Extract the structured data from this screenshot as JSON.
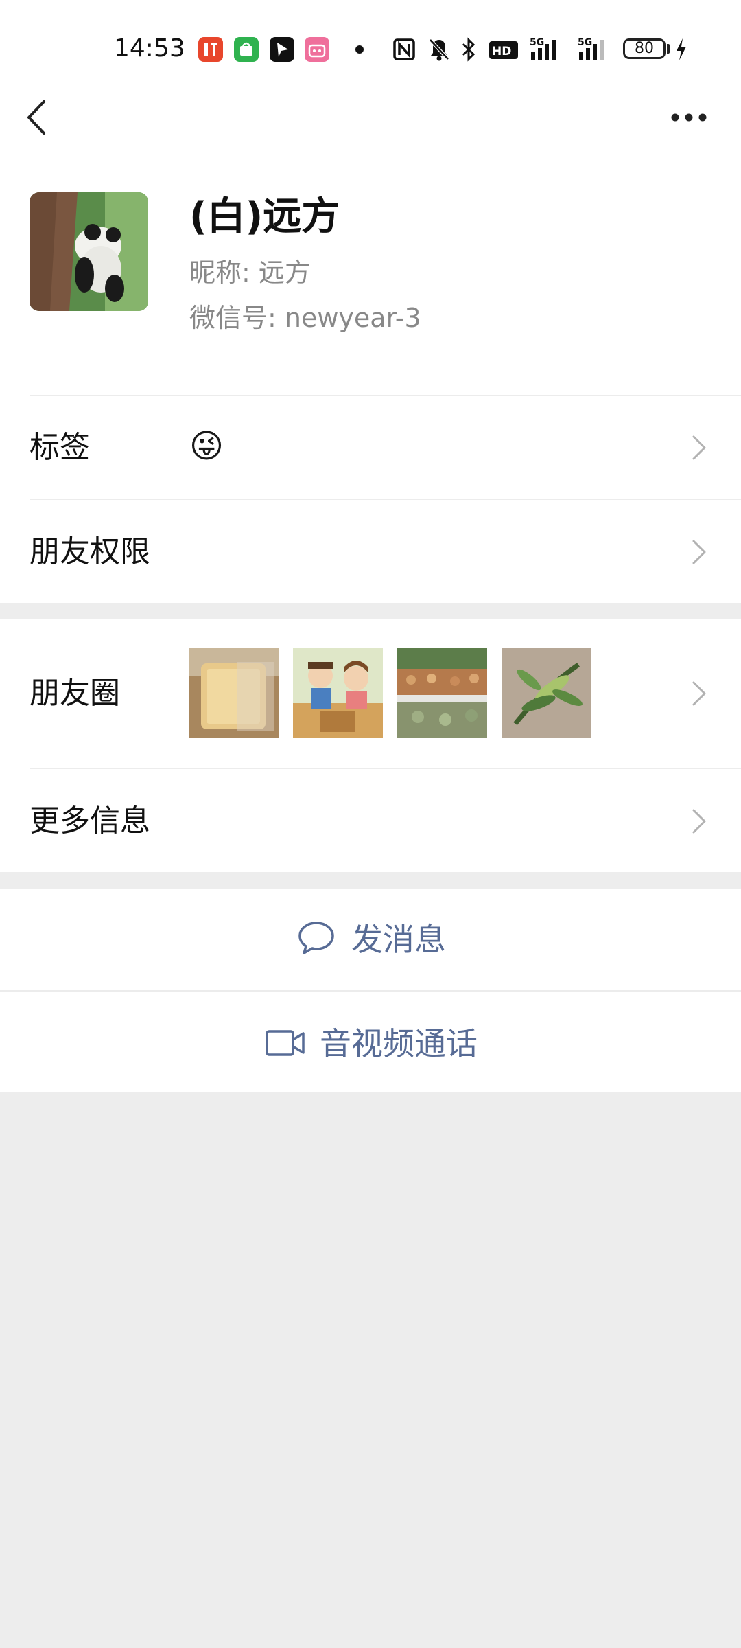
{
  "status_bar": {
    "time": "14:53",
    "app_icons": [
      "listen-app-icon",
      "shopping-app-icon",
      "arrow-app-icon",
      "bilibili-app-icon"
    ],
    "signal_icons": [
      "nfc-icon",
      "mute-bell-icon",
      "bluetooth-icon",
      "hd-icon",
      "5g-signal-icon",
      "5g-signal-icon"
    ],
    "battery": "80"
  },
  "nav": {
    "back_icon": "back-chevron-icon",
    "more_icon": "more-dots-icon"
  },
  "profile": {
    "display_name": "(白)远方",
    "nickname": "昵称: 远方",
    "wechat_id": "微信号: newyear-3"
  },
  "rows": {
    "tags_label": "标签",
    "tags_value": "😜",
    "permissions_label": "朋友权限",
    "moments_label": "朋友圈",
    "more_info_label": "更多信息"
  },
  "actions": {
    "message_label": "发消息",
    "call_label": "音视频通话"
  },
  "colors": {
    "link_blue": "#576b95",
    "background": "#ededed",
    "card": "#ffffff",
    "secondary_text": "#888888"
  }
}
